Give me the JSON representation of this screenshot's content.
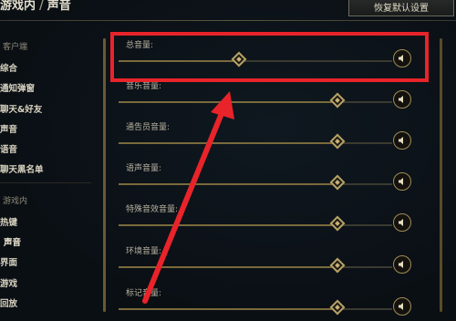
{
  "header": {
    "crumb_parent": "游戏内",
    "crumb_sep": "/",
    "crumb_current": "声音",
    "reset_label": "恢复默认设置"
  },
  "sidebar": {
    "client_section": "客户端",
    "client_items": [
      "综合",
      "通知弹窗",
      "聊天&好友",
      "声音",
      "语音",
      "聊天黑名单"
    ],
    "ingame_section": "游戏内",
    "ingame_items": [
      "热键",
      "声音",
      "界面",
      "游戏",
      "回放"
    ],
    "active_ingame": "声音"
  },
  "sliders": [
    {
      "label": "总音量:",
      "value": 0.44
    },
    {
      "label": "音乐音量:",
      "value": 0.8
    },
    {
      "label": "通告员音量:",
      "value": 0.8
    },
    {
      "label": "语声音量:",
      "value": 0.8
    },
    {
      "label": "特殊音效音量:",
      "value": 0.8
    },
    {
      "label": "环境音量:",
      "value": 0.8
    },
    {
      "label": "标记音量:",
      "value": 0.8
    }
  ],
  "icons": {
    "mute": "speaker-icon",
    "thumb": "diamond-thumb-icon",
    "annotation_arrow": "red-arrow-icon"
  },
  "colors": {
    "annotation": "#e8242a",
    "accent_gold": "#b8a266",
    "background": "#0a0f14"
  }
}
